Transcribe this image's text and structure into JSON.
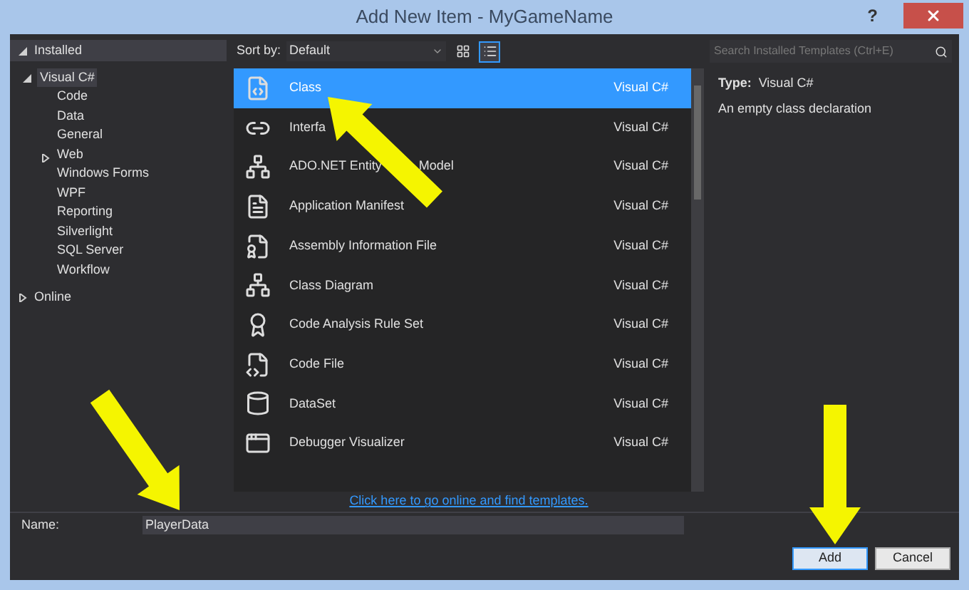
{
  "window": {
    "title": "Add New Item - MyGameName",
    "help": "?"
  },
  "tree": {
    "installed": {
      "label": "Installed",
      "expanded": true,
      "children": [
        {
          "label": "Visual C#",
          "expanded": true,
          "selected": true,
          "children": [
            {
              "label": "Code",
              "selected": false
            },
            {
              "label": "Data",
              "selected": false
            },
            {
              "label": "General",
              "selected": false
            },
            {
              "label": "Web",
              "selected": false,
              "expanded": false
            },
            {
              "label": "Windows Forms",
              "selected": false
            },
            {
              "label": "WPF",
              "selected": false
            },
            {
              "label": "Reporting",
              "selected": false
            },
            {
              "label": "Silverlight",
              "selected": false
            },
            {
              "label": "SQL Server",
              "selected": false
            },
            {
              "label": "Workflow",
              "selected": false
            }
          ]
        }
      ]
    },
    "online": {
      "label": "Online",
      "expanded": false
    }
  },
  "sort": {
    "label": "Sort by:",
    "value": "Default"
  },
  "view_buttons": [
    {
      "selected": false
    },
    {
      "selected": true
    }
  ],
  "templates": [
    {
      "name": "Class",
      "language": "Visual C#",
      "selected": true
    },
    {
      "name": "Interfa",
      "language": "Visual C#",
      "selected": false
    },
    {
      "name": "ADO.NET Entity",
      "name_after": "Model",
      "language": "Visual C#",
      "selected": false
    },
    {
      "name": "Application Manifest",
      "language": "Visual C#",
      "selected": false
    },
    {
      "name": "Assembly Information File",
      "language": "Visual C#",
      "selected": false
    },
    {
      "name": "Class Diagram",
      "language": "Visual C#",
      "selected": false
    },
    {
      "name": "Code Analysis Rule Set",
      "language": "Visual C#",
      "selected": false
    },
    {
      "name": "Code File",
      "language": "Visual C#",
      "selected": false
    },
    {
      "name": "DataSet",
      "language": "Visual C#",
      "selected": false
    },
    {
      "name": "Debugger Visualizer",
      "language": "Visual C#",
      "selected": false
    }
  ],
  "online_link": "Click here to go online and find templates.",
  "search": {
    "placeholder": "Search Installed Templates (Ctrl+E)"
  },
  "details": {
    "type_label": "Type:",
    "type_value": "Visual C#",
    "description": "An empty class declaration"
  },
  "name_field": {
    "label": "Name:",
    "value": "PlayerData"
  },
  "buttons": [
    {
      "label": "Add",
      "default": true
    },
    {
      "label": "Cancel",
      "default": false
    }
  ]
}
